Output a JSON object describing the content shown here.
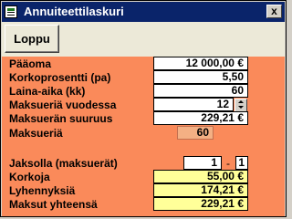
{
  "window": {
    "title": "Annuiteettilaskuri",
    "close_label": "x"
  },
  "toolbar": {
    "quit_label": "Loppu"
  },
  "form": {
    "principal_label": "Pääoma",
    "principal_value": "12 000,00 €",
    "interest_label": "Korkoprosentti (pa)",
    "interest_value": "5,50",
    "term_label": "Laina-aika (kk)",
    "term_value": "60",
    "payments_per_year_label": "Maksueriä vuodessa",
    "payments_per_year_value": "12",
    "payment_size_label": "Maksuerän suuruus",
    "payment_size_value": "229,21 €",
    "payment_count_label": "Maksueriä",
    "payment_count_value": "60"
  },
  "period": {
    "label": "Jaksolla (maksuerät)",
    "from_value": "1",
    "separator": "-",
    "to_value": "1",
    "interest_label": "Korkoja",
    "interest_value": "55,00 €",
    "repayment_label": "Lyhennyksiä",
    "repayment_value": "174,21 €",
    "total_label": "Maksut yhteensä",
    "total_value": "229,21 €"
  }
}
